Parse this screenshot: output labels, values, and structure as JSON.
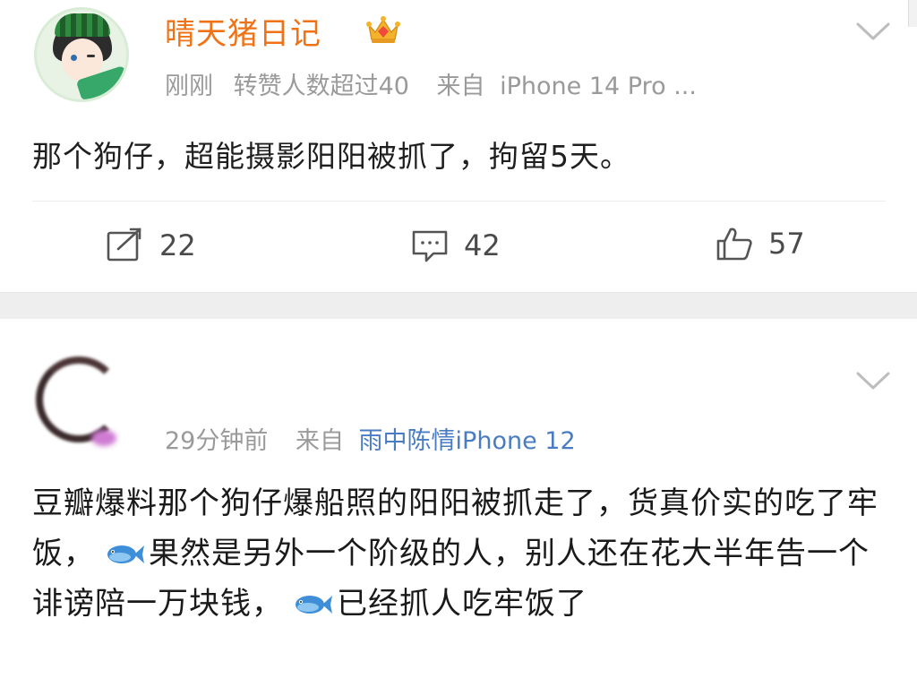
{
  "posts": [
    {
      "username": "晴天猪日记",
      "time": "刚刚",
      "extra": "转赞人数超过40",
      "source_prefix": "来自",
      "source": "iPhone 14 Pro ...",
      "content": "那个狗仔，超能摄影阳阳被抓了，拘留5天。",
      "actions": {
        "reposts": "22",
        "comments": "42",
        "likes": "57"
      },
      "accent": "#ef7316"
    },
    {
      "time": "29分钟前",
      "source_prefix": "来自",
      "source": "雨中陈情iPhone 12",
      "content_parts": [
        "豆瓣爆料那个狗仔爆船照的阳阳被抓走了，货真价实的吃了牢饭，",
        "果然是另外一个阶级的人，别人还在花大半年告一个诽谤陪一万块钱，",
        "已经抓人吃牢饭了"
      ],
      "emoji": [
        "fish-emoji",
        "fish-emoji"
      ],
      "source_color": "#4a7cc4"
    }
  ],
  "icons": [
    "avatar",
    "crown-icon",
    "chevron-down-icon",
    "repost-icon",
    "comment-icon",
    "like-icon",
    "fish-emoji"
  ]
}
